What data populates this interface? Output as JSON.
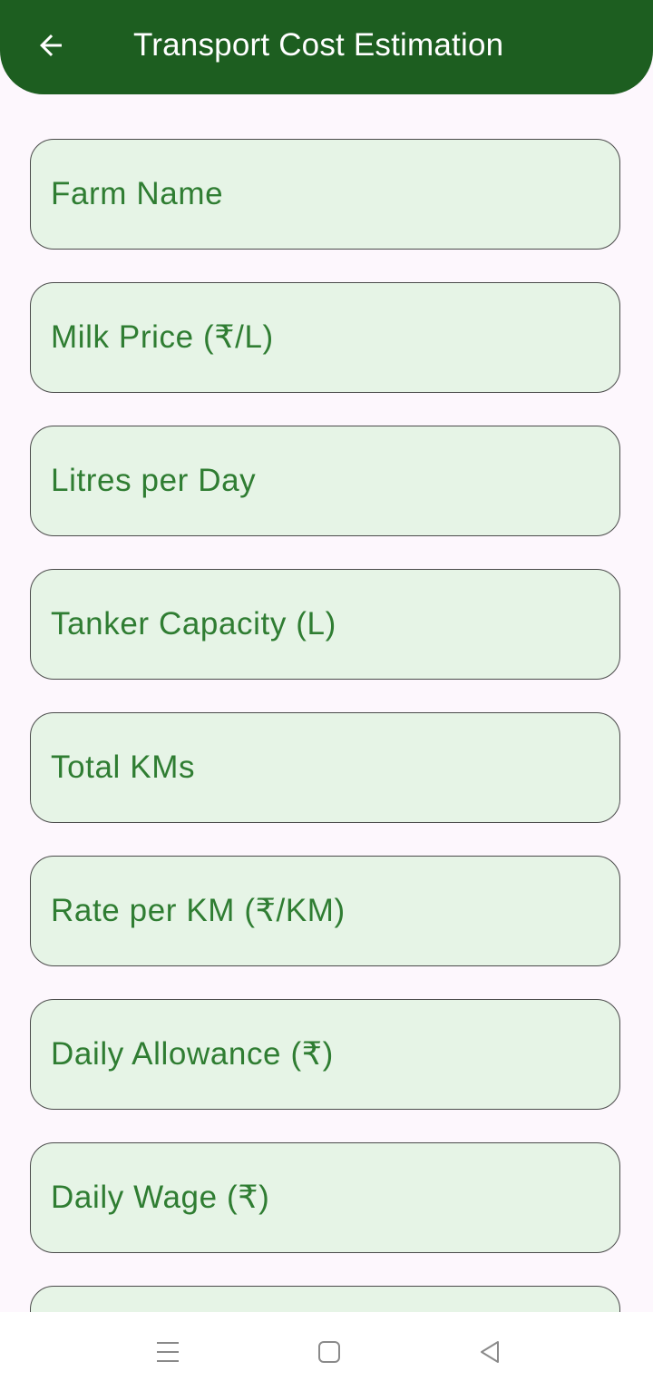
{
  "app_bar": {
    "title": "Transport Cost Estimation",
    "back_icon": "arrow-left-icon",
    "background_color": "#1d5e20",
    "title_color": "#ffffff"
  },
  "form": {
    "field_background": "#e6f4e6",
    "label_color": "#2f7d32",
    "fields": [
      {
        "placeholder": "Farm Name",
        "value": ""
      },
      {
        "placeholder": "Milk Price (₹/L)",
        "value": ""
      },
      {
        "placeholder": "Litres per Day",
        "value": ""
      },
      {
        "placeholder": "Tanker Capacity (L)",
        "value": ""
      },
      {
        "placeholder": "Total KMs",
        "value": ""
      },
      {
        "placeholder": "Rate per KM (₹/KM)",
        "value": ""
      },
      {
        "placeholder": "Daily Allowance (₹)",
        "value": ""
      },
      {
        "placeholder": "Daily Wage (₹)",
        "value": ""
      },
      {
        "placeholder": "",
        "value": ""
      }
    ]
  },
  "system_nav": {
    "menu_icon": "menu-lines-icon",
    "home_icon": "square-home-icon",
    "back_icon": "triangle-back-icon"
  }
}
